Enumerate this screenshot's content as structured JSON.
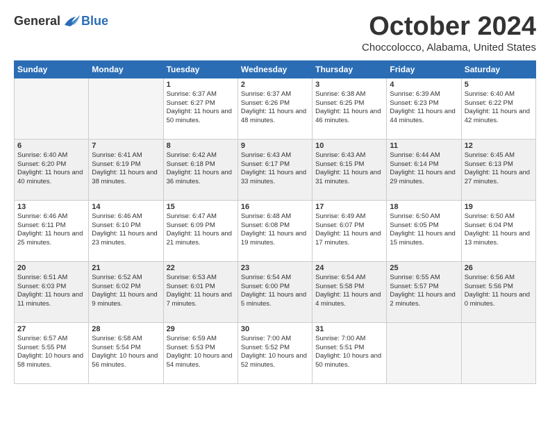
{
  "header": {
    "logo_general": "General",
    "logo_blue": "Blue",
    "title": "October 2024",
    "location": "Choccolocco, Alabama, United States"
  },
  "days_of_week": [
    "Sunday",
    "Monday",
    "Tuesday",
    "Wednesday",
    "Thursday",
    "Friday",
    "Saturday"
  ],
  "weeks": [
    [
      {
        "day": "",
        "info": ""
      },
      {
        "day": "",
        "info": ""
      },
      {
        "day": "1",
        "info": "Sunrise: 6:37 AM\nSunset: 6:27 PM\nDaylight: 11 hours and 50 minutes."
      },
      {
        "day": "2",
        "info": "Sunrise: 6:37 AM\nSunset: 6:26 PM\nDaylight: 11 hours and 48 minutes."
      },
      {
        "day": "3",
        "info": "Sunrise: 6:38 AM\nSunset: 6:25 PM\nDaylight: 11 hours and 46 minutes."
      },
      {
        "day": "4",
        "info": "Sunrise: 6:39 AM\nSunset: 6:23 PM\nDaylight: 11 hours and 44 minutes."
      },
      {
        "day": "5",
        "info": "Sunrise: 6:40 AM\nSunset: 6:22 PM\nDaylight: 11 hours and 42 minutes."
      }
    ],
    [
      {
        "day": "6",
        "info": "Sunrise: 6:40 AM\nSunset: 6:20 PM\nDaylight: 11 hours and 40 minutes."
      },
      {
        "day": "7",
        "info": "Sunrise: 6:41 AM\nSunset: 6:19 PM\nDaylight: 11 hours and 38 minutes."
      },
      {
        "day": "8",
        "info": "Sunrise: 6:42 AM\nSunset: 6:18 PM\nDaylight: 11 hours and 36 minutes."
      },
      {
        "day": "9",
        "info": "Sunrise: 6:43 AM\nSunset: 6:17 PM\nDaylight: 11 hours and 33 minutes."
      },
      {
        "day": "10",
        "info": "Sunrise: 6:43 AM\nSunset: 6:15 PM\nDaylight: 11 hours and 31 minutes."
      },
      {
        "day": "11",
        "info": "Sunrise: 6:44 AM\nSunset: 6:14 PM\nDaylight: 11 hours and 29 minutes."
      },
      {
        "day": "12",
        "info": "Sunrise: 6:45 AM\nSunset: 6:13 PM\nDaylight: 11 hours and 27 minutes."
      }
    ],
    [
      {
        "day": "13",
        "info": "Sunrise: 6:46 AM\nSunset: 6:11 PM\nDaylight: 11 hours and 25 minutes."
      },
      {
        "day": "14",
        "info": "Sunrise: 6:46 AM\nSunset: 6:10 PM\nDaylight: 11 hours and 23 minutes."
      },
      {
        "day": "15",
        "info": "Sunrise: 6:47 AM\nSunset: 6:09 PM\nDaylight: 11 hours and 21 minutes."
      },
      {
        "day": "16",
        "info": "Sunrise: 6:48 AM\nSunset: 6:08 PM\nDaylight: 11 hours and 19 minutes."
      },
      {
        "day": "17",
        "info": "Sunrise: 6:49 AM\nSunset: 6:07 PM\nDaylight: 11 hours and 17 minutes."
      },
      {
        "day": "18",
        "info": "Sunrise: 6:50 AM\nSunset: 6:05 PM\nDaylight: 11 hours and 15 minutes."
      },
      {
        "day": "19",
        "info": "Sunrise: 6:50 AM\nSunset: 6:04 PM\nDaylight: 11 hours and 13 minutes."
      }
    ],
    [
      {
        "day": "20",
        "info": "Sunrise: 6:51 AM\nSunset: 6:03 PM\nDaylight: 11 hours and 11 minutes."
      },
      {
        "day": "21",
        "info": "Sunrise: 6:52 AM\nSunset: 6:02 PM\nDaylight: 11 hours and 9 minutes."
      },
      {
        "day": "22",
        "info": "Sunrise: 6:53 AM\nSunset: 6:01 PM\nDaylight: 11 hours and 7 minutes."
      },
      {
        "day": "23",
        "info": "Sunrise: 6:54 AM\nSunset: 6:00 PM\nDaylight: 11 hours and 5 minutes."
      },
      {
        "day": "24",
        "info": "Sunrise: 6:54 AM\nSunset: 5:58 PM\nDaylight: 11 hours and 4 minutes."
      },
      {
        "day": "25",
        "info": "Sunrise: 6:55 AM\nSunset: 5:57 PM\nDaylight: 11 hours and 2 minutes."
      },
      {
        "day": "26",
        "info": "Sunrise: 6:56 AM\nSunset: 5:56 PM\nDaylight: 11 hours and 0 minutes."
      }
    ],
    [
      {
        "day": "27",
        "info": "Sunrise: 6:57 AM\nSunset: 5:55 PM\nDaylight: 10 hours and 58 minutes."
      },
      {
        "day": "28",
        "info": "Sunrise: 6:58 AM\nSunset: 5:54 PM\nDaylight: 10 hours and 56 minutes."
      },
      {
        "day": "29",
        "info": "Sunrise: 6:59 AM\nSunset: 5:53 PM\nDaylight: 10 hours and 54 minutes."
      },
      {
        "day": "30",
        "info": "Sunrise: 7:00 AM\nSunset: 5:52 PM\nDaylight: 10 hours and 52 minutes."
      },
      {
        "day": "31",
        "info": "Sunrise: 7:00 AM\nSunset: 5:51 PM\nDaylight: 10 hours and 50 minutes."
      },
      {
        "day": "",
        "info": ""
      },
      {
        "day": "",
        "info": ""
      }
    ]
  ]
}
